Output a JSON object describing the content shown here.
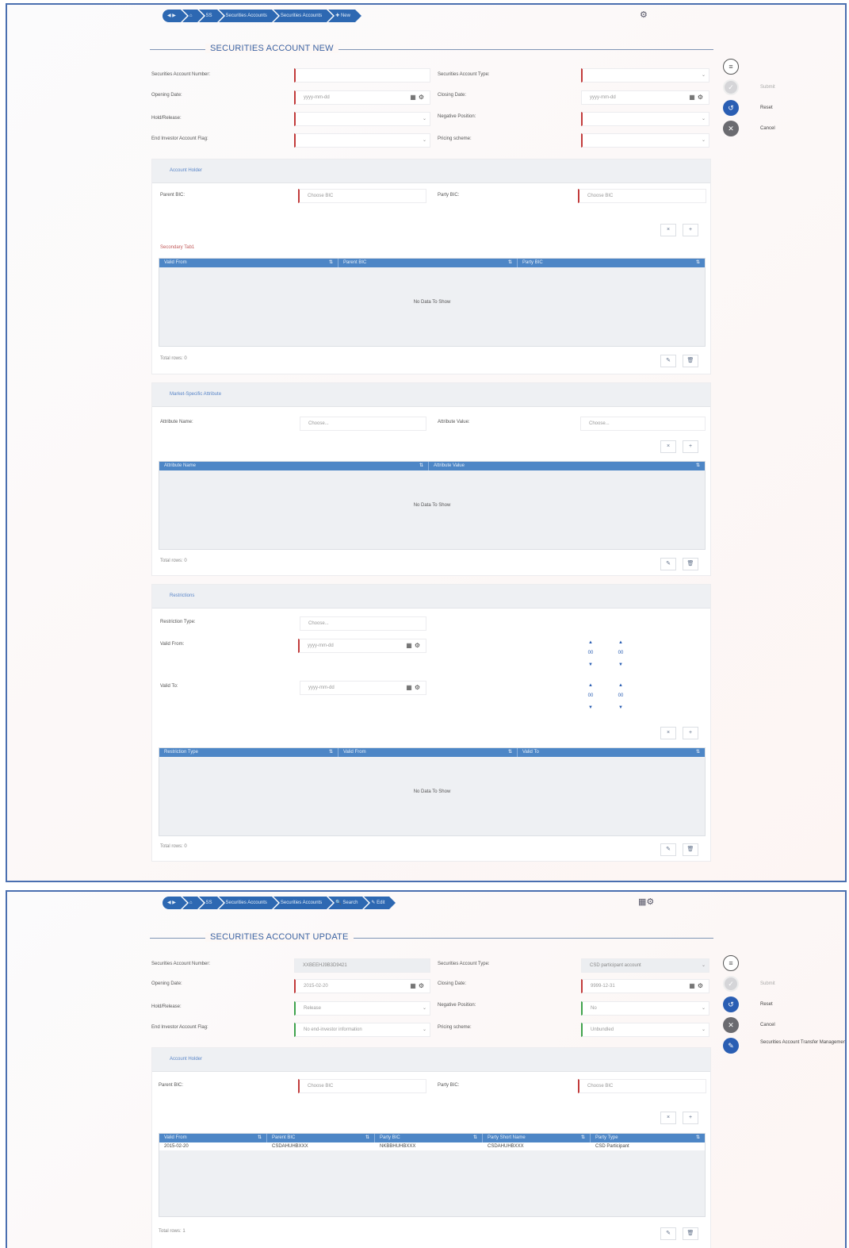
{
  "shot1": {
    "breadcrumbs": [
      "◀ ▶",
      "⌂",
      "SS",
      "Securities Accounts",
      "Securities Accounts",
      "✚ New"
    ],
    "top_icon": "person-gear-icon",
    "title": "SECURITIES ACCOUNT NEW",
    "fields": {
      "securities_account_number_label": "Securities Account Number:",
      "securities_account_type_label": "Securities Account Type:",
      "opening_date_label": "Opening Date:",
      "opening_date_placeholder": "yyyy-mm-dd",
      "closing_date_label": "Closing Date:",
      "closing_date_placeholder": "yyyy-mm-dd",
      "hold_release_label": "Hold/Release:",
      "negative_position_label": "Negative Position:",
      "end_investor_flag_label": "End Investor Account Flag:",
      "pricing_scheme_label": "Pricing scheme:"
    },
    "side_actions": [
      {
        "icon": "menu-icon",
        "label": ""
      },
      {
        "icon": "submit-icon",
        "label": "Submit"
      },
      {
        "icon": "reset-icon",
        "label": "Reset"
      },
      {
        "icon": "cancel-icon",
        "label": "Cancel"
      }
    ],
    "account_holder": {
      "section_title": "Account Holder",
      "parent_bic_label": "Parent BIC:",
      "parent_bic_placeholder": "Choose BIC",
      "party_bic_label": "Party BIC:",
      "party_bic_placeholder": "Choose BIC",
      "subheading": "Secondary Tab1",
      "columns": [
        "Valid From",
        "Parent BIC",
        "Party BIC"
      ],
      "no_data": "No Data To Show",
      "total": "Total rows: 0"
    },
    "market_attributes": {
      "section_title": "Market-Specific Attribute",
      "attr_name_label": "Attribute Name:",
      "attr_name_placeholder": "Choose...",
      "attr_value_label": "Attribute Value:",
      "attr_value_placeholder": "Choose...",
      "columns": [
        "Attribute Name",
        "Attribute Value"
      ],
      "no_data": "No Data To Show",
      "total": "Total rows: 0"
    },
    "restrictions": {
      "section_title": "Restrictions",
      "type_label": "Restriction Type:",
      "type_placeholder": "Choose...",
      "valid_from_label": "Valid From:",
      "valid_from_placeholder": "yyyy-mm-dd",
      "valid_to_label": "Valid To:",
      "valid_to_placeholder": "yyyy-mm-dd",
      "time_hh": "00",
      "time_mm": "00",
      "columns": [
        "Restriction Type",
        "Valid From",
        "Valid To"
      ],
      "no_data": "No Data To Show",
      "total": "Total rows: 0"
    },
    "add_icon": "×",
    "plus_icon": "+",
    "edit_icon": "✎",
    "delete_icon": "🗑"
  },
  "shot2": {
    "breadcrumbs": [
      "◀ ▶",
      "⌂",
      "SS",
      "Securities Accounts",
      "Securities Accounts",
      "🔍 Search",
      "✎ Edit"
    ],
    "top_icon": "persons-gear-icon",
    "title": "SECURITIES ACCOUNT UPDATE",
    "fields": {
      "securities_account_number_label": "Securities Account Number:",
      "securities_account_number_value": "XXBEEHJ9B3D9421",
      "securities_account_type_label": "Securities Account Type:",
      "securities_account_type_value": "CSD participant account",
      "opening_date_label": "Opening Date:",
      "opening_date_value": "2015-02-20",
      "closing_date_label": "Closing Date:",
      "closing_date_value": "9999-12-31",
      "hold_release_label": "Hold/Release:",
      "hold_release_value": "Release",
      "negative_position_label": "Negative Position:",
      "negative_position_value": "No",
      "end_investor_flag_label": "End Investor Account Flag:",
      "end_investor_flag_value": "No end-investor information",
      "pricing_scheme_label": "Pricing scheme:",
      "pricing_scheme_value": "Unbundled"
    },
    "side_actions": [
      {
        "icon": "menu-icon",
        "label": ""
      },
      {
        "icon": "submit-icon",
        "label": "Submit"
      },
      {
        "icon": "reset-icon",
        "label": "Reset"
      },
      {
        "icon": "cancel-icon",
        "label": "Cancel"
      },
      {
        "icon": "edit-icon",
        "label": "Securities Account Transfer Management"
      }
    ],
    "account_holder": {
      "section_title": "Account Holder",
      "parent_bic_label": "Parent BIC:",
      "parent_bic_placeholder": "Choose BIC",
      "party_bic_label": "Party BIC:",
      "party_bic_placeholder": "Choose BIC",
      "columns": [
        "Valid From",
        "Parent BIC",
        "Party BIC",
        "Party Short Name",
        "Party Type"
      ],
      "rows": [
        [
          "2015-02-20",
          "CSDAHUHBXXX",
          "NKBBHUHBXXX",
          "CSDAHUHBXXX",
          "CSD Participant"
        ]
      ],
      "total": "Total rows: 1"
    },
    "add_icon": "×",
    "plus_icon": "+",
    "edit_icon": "✎",
    "delete_icon": "🗑"
  },
  "colors": {
    "accent": "#2d68b2",
    "required": "#c23b3b",
    "valid": "#3fa34d",
    "grid_header": "#4d86c6"
  }
}
